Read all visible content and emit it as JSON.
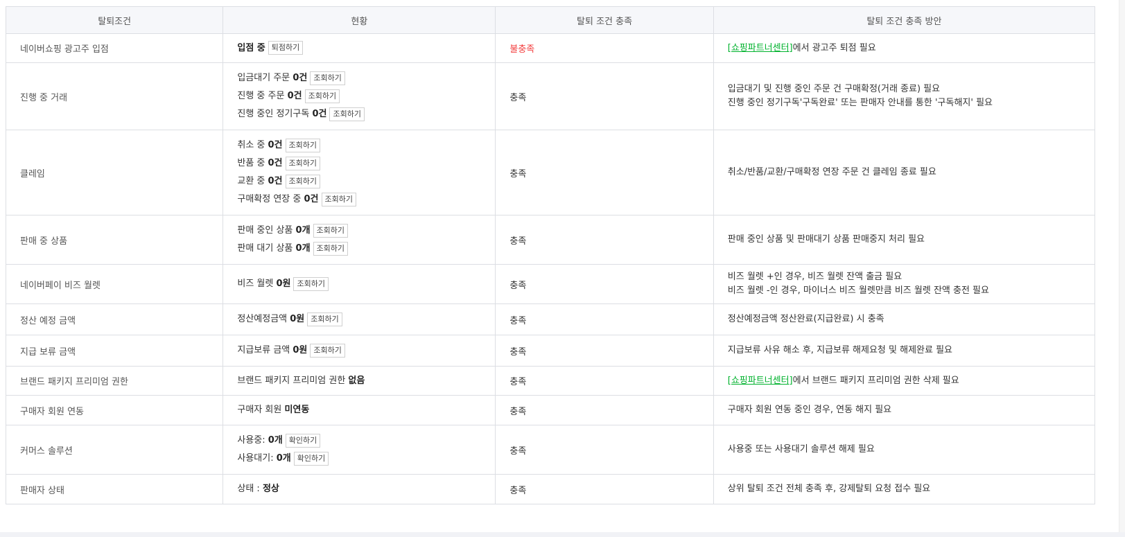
{
  "headers": [
    "탈퇴조건",
    "현황",
    "탈퇴 조건 충족",
    "탈퇴 조건 충족 방안"
  ],
  "colors": {
    "unmet": "#f33d3d",
    "link": "#00b22d",
    "header_bg": "#f6f7fa",
    "border": "#dcdee3"
  },
  "rows": [
    {
      "condition": "네이버쇼핑 광고주 입점",
      "status": [
        {
          "pre": "",
          "value": "입점 중",
          "button": "퇴점하기"
        }
      ],
      "met": "불충족",
      "method": [
        {
          "link": "[쇼핑파트너센터]",
          "text": "에서 광고주 퇴점 필요"
        }
      ]
    },
    {
      "condition": "진행 중 거래",
      "status": [
        {
          "pre": "입금대기 주문 ",
          "value": "0건",
          "button": "조회하기"
        },
        {
          "pre": "진행 중 주문 ",
          "value": "0건",
          "button": "조회하기"
        },
        {
          "pre": "진행 중인 정기구독 ",
          "value": "0건",
          "button": "조회하기"
        }
      ],
      "met": "충족",
      "method": [
        {
          "link": "",
          "text": "입금대기 및 진행 중인 주문 건 구매확정(거래 종료) 필요"
        },
        {
          "link": "",
          "text": "진행 중인 정기구독'구독완료' 또는 판매자 안내를 통한 '구독해지' 필요"
        }
      ]
    },
    {
      "condition": "클레임",
      "status": [
        {
          "pre": "취소 중 ",
          "value": "0건",
          "button": "조회하기"
        },
        {
          "pre": "반품 중 ",
          "value": "0건",
          "button": "조회하기"
        },
        {
          "pre": "교환 중 ",
          "value": "0건",
          "button": "조회하기"
        },
        {
          "pre": "구매확정 연장 중 ",
          "value": "0건",
          "button": "조회하기"
        }
      ],
      "met": "충족",
      "method": [
        {
          "link": "",
          "text": "취소/반품/교환/구매확정 연장 주문 건 클레임 종료 필요"
        }
      ]
    },
    {
      "condition": "판매 중 상품",
      "status": [
        {
          "pre": "판매 중인 상품 ",
          "value": "0개",
          "button": "조회하기"
        },
        {
          "pre": "판매 대기 상품 ",
          "value": "0개",
          "button": "조회하기"
        }
      ],
      "met": "충족",
      "method": [
        {
          "link": "",
          "text": "판매 중인 상품 및 판매대기 상품 판매중지 처리 필요"
        }
      ]
    },
    {
      "condition": "네이버페이 비즈 월렛",
      "status": [
        {
          "pre": "비즈 월렛 ",
          "value": "0원",
          "button": "조회하기"
        }
      ],
      "met": "충족",
      "method": [
        {
          "link": "",
          "text": "비즈 월렛 +인 경우, 비즈 월렛 잔액 출금 필요"
        },
        {
          "link": "",
          "text": "비즈 월렛 -인 경우, 마이너스 비즈 월렛만큼 비즈 월렛 잔액 충전 필요"
        }
      ]
    },
    {
      "condition": "정산 예정 금액",
      "status": [
        {
          "pre": "정산예정금액 ",
          "value": "0원",
          "button": "조회하기"
        }
      ],
      "met": "충족",
      "method": [
        {
          "link": "",
          "text": "정산예정금액 정산완료(지급완료) 시 충족"
        }
      ]
    },
    {
      "condition": "지급 보류 금액",
      "status": [
        {
          "pre": "지급보류 금액 ",
          "value": "0원",
          "button": "조회하기"
        }
      ],
      "met": "충족",
      "method": [
        {
          "link": "",
          "text": "지급보류 사유 해소 후, 지급보류 해제요청 및 해제완료 필요"
        }
      ]
    },
    {
      "condition": "브랜드 패키지 프리미엄 권한",
      "status": [
        {
          "pre": "브랜드 패키지 프리미엄 권한 ",
          "value": "없음",
          "button": ""
        }
      ],
      "met": "충족",
      "method": [
        {
          "link": "[쇼핑파트너센터]",
          "text": "에서 브랜드 패키지 프리미엄 권한 삭제 필요"
        }
      ]
    },
    {
      "condition": "구매자 회원 연동",
      "status": [
        {
          "pre": "구매자 회원 ",
          "value": "미연동",
          "button": ""
        }
      ],
      "met": "충족",
      "method": [
        {
          "link": "",
          "text": "구매자 회원 연동 중인 경우, 연동 해지 필요"
        }
      ]
    },
    {
      "condition": "커머스 솔루션",
      "status": [
        {
          "pre": "사용중: ",
          "value": "0개",
          "button": "확인하기"
        },
        {
          "pre": "사용대기: ",
          "value": "0개",
          "button": "확인하기"
        }
      ],
      "met": "충족",
      "method": [
        {
          "link": "",
          "text": "사용중 또는 사용대기 솔루션 해제 필요"
        }
      ]
    },
    {
      "condition": "판매자 상태",
      "status": [
        {
          "pre": "상태 : ",
          "value": "정상",
          "button": ""
        }
      ],
      "met": "충족",
      "method": [
        {
          "link": "",
          "text": "상위 탈퇴 조건 전체 충족 후, 강제탈퇴 요청 접수 필요"
        }
      ]
    }
  ]
}
